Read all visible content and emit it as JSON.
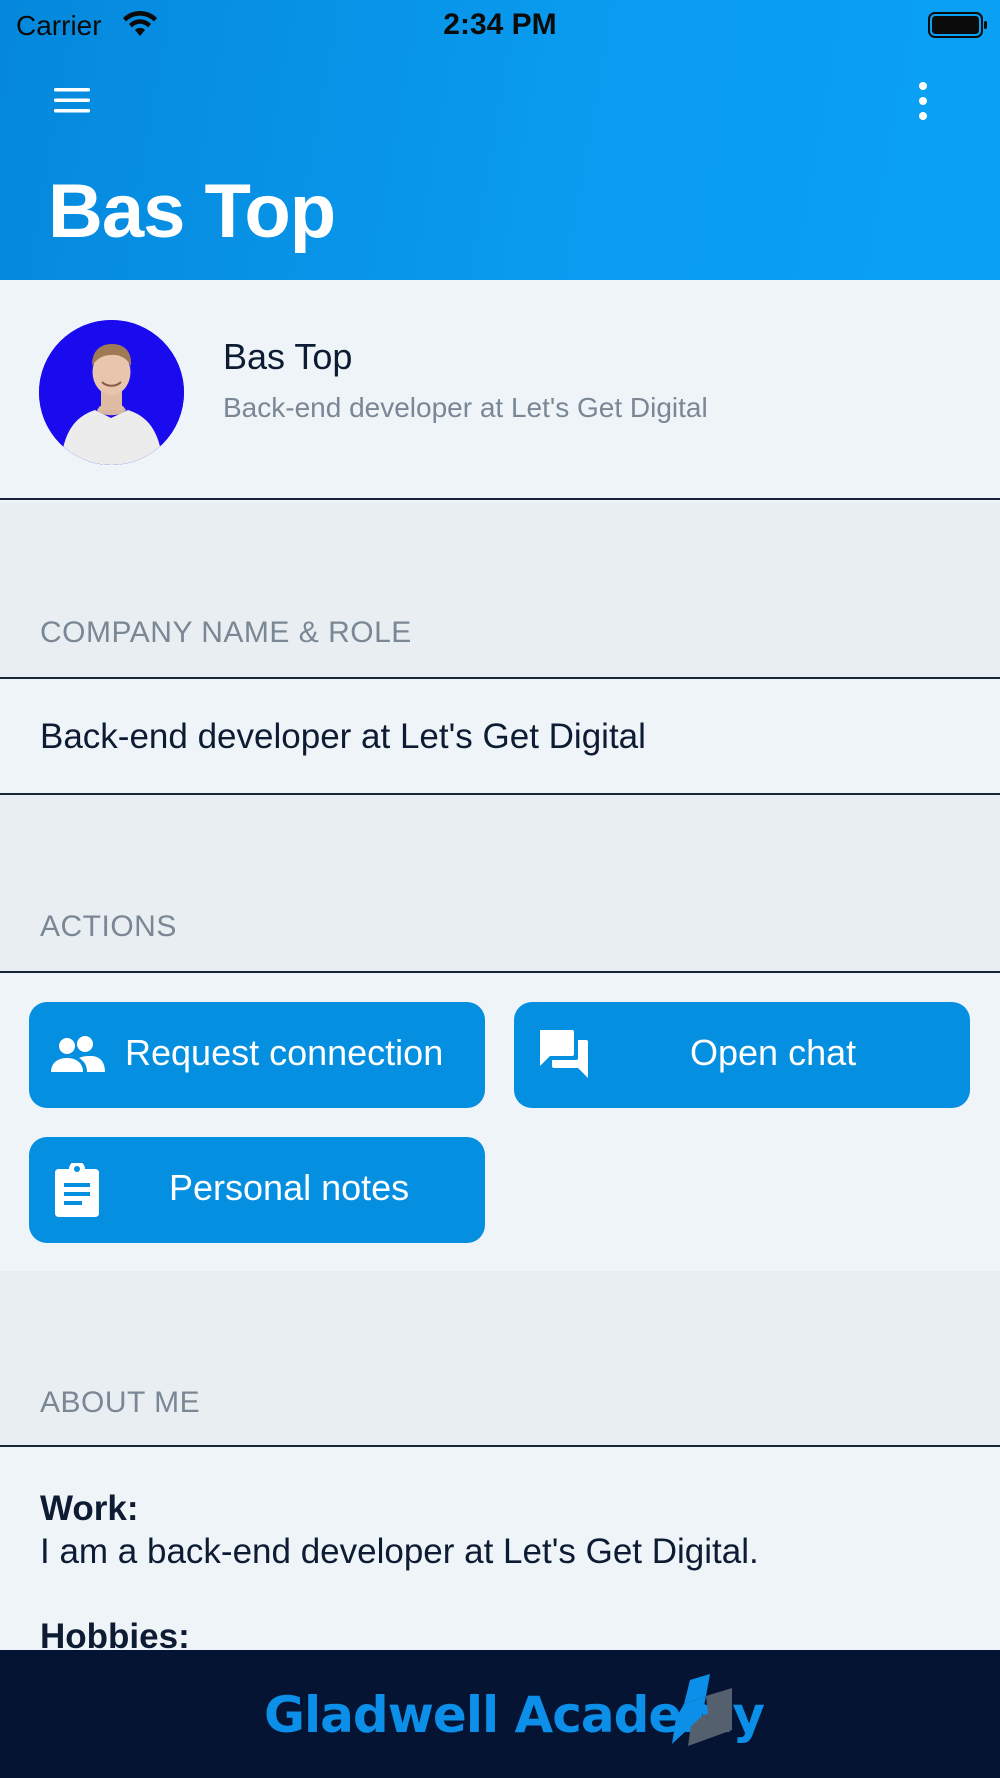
{
  "status_bar": {
    "carrier": "Carrier",
    "time": "2:34 PM"
  },
  "header": {
    "title": "Bas Top",
    "menu_icon": "hamburger-menu-icon",
    "more_icon": "more-vertical-icon",
    "gradient_start": "#0588dc",
    "gradient_end": "#0aa1f5"
  },
  "profile": {
    "name": "Bas Top",
    "subtitle": "Back-end developer at Let's Get Digital",
    "avatar_background": "#1a0aee"
  },
  "sections": {
    "company_label": "COMPANY NAME & ROLE",
    "company_value": "Back-end developer at Let's Get Digital",
    "actions_label": "ACTIONS",
    "about_label": "ABOUT ME"
  },
  "actions": {
    "request_connection": {
      "label": "Request connection",
      "icon": "people-icon"
    },
    "open_chat": {
      "label": "Open chat",
      "icon": "chat-icon"
    },
    "personal_notes": {
      "label": "Personal notes",
      "icon": "clipboard-icon"
    },
    "button_color": "#058fe0"
  },
  "about": {
    "work_heading": "Work:",
    "work_text": "I am a back-end developer at Let's Get Digital.",
    "hobbies_heading": "Hobbies:"
  },
  "footer": {
    "brand": "Gladwell Academy",
    "background": "#061433",
    "brand_color": "#0b8fe8"
  }
}
